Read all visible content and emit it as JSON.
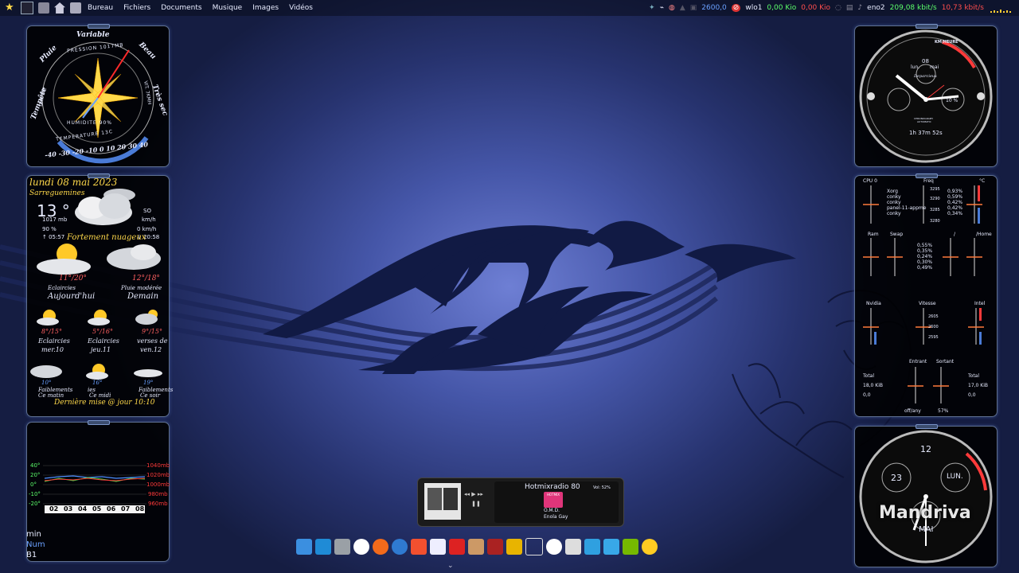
{
  "top_panel": {
    "menu": [
      "Bureau",
      "Fichiers",
      "Documents",
      "Musique",
      "Images",
      "Vidéos"
    ],
    "freq": "2600,0",
    "wlo1_label": "wlo1",
    "wlo1_down": "0,00 Kio",
    "wlo1_up": "0,00 Kio",
    "eno2_label": "eno2",
    "eno2_down": "209,08 kbit/s",
    "eno2_up": "10,73 kbit/s"
  },
  "barometer": {
    "labels": [
      "Variable",
      "Pluie",
      "Beau",
      "Tempête",
      "Très sec"
    ],
    "pression": "PRESSION 1017MB",
    "humidite": "HUMIDITE 90%",
    "temperature": "TEMPERATURE 13C",
    "scale": "-40 -30 -20 -10 0 10 20 30 40",
    "wind": "VIT. 7KMH",
    "dir": "DIR. SO"
  },
  "weather": {
    "date": "lundi 08 mai 2023",
    "city": "Sarreguemines",
    "temp": "13 °",
    "pressure": "1017 mb",
    "humidity": "90 %",
    "sunrise": "↑ 05:57",
    "sunset": "↓ 20:58",
    "wind_dir": "SO",
    "wind_speed": "km/h",
    "gust": "0 km/h",
    "condition": "Fortement nuageux",
    "today": {
      "range": "11°/20°",
      "desc": "Eclaircies",
      "label": "Aujourd'hui"
    },
    "tomorrow": {
      "range": "12°/18°",
      "desc": "Pluie modérée",
      "label": "Demain"
    },
    "days": [
      {
        "range": "8°/15°",
        "desc": "Eclaircies",
        "day": "mer.10"
      },
      {
        "range": "5°/16°",
        "desc": "Eclaircies",
        "day": "jeu.11"
      },
      {
        "range": "9°/15°",
        "desc": "verses de",
        "day": "ven.12"
      }
    ],
    "periods": [
      {
        "temp": "10°",
        "desc": "Faiblements",
        "when": "Ce matin"
      },
      {
        "temp": "16°",
        "desc": "ies",
        "when": "Ce midi"
      },
      {
        "temp": "19°",
        "desc": "Faiblements",
        "when": "Ce soir"
      }
    ],
    "updated": "Dernière mise @ jour  10:10"
  },
  "graph": {
    "temps": [
      "40°",
      "20°",
      "0°",
      "-10°",
      "-20°"
    ],
    "pressures": [
      "1040mb",
      "1020mb",
      "1000mb",
      "980mb",
      "960mb"
    ],
    "days": [
      "02",
      "03",
      "04",
      "05",
      "06",
      "07",
      "08"
    ]
  },
  "status": {
    "line1": "min",
    "line2": "Num",
    "line3": "B1"
  },
  "clock": {
    "date": "08",
    "day": "lun.",
    "month": "mai",
    "brand": "Deparcieux",
    "sub1": "CHRONOGRAPH",
    "sub2": "AUTOMATIC",
    "duration": "1h 37m 52s",
    "pct": "10 %",
    "mode": "KM/HEURE"
  },
  "sysmon": {
    "cpu_label": "CPU 0",
    "freq_label": "Freq",
    "temp_label": "°C",
    "processes": [
      "Xorg",
      "conky",
      "conky",
      "panel-11-appme",
      "conky"
    ],
    "process_pct": [
      "0,93%",
      "0,59%",
      "0,42%",
      "0,42%",
      "0,34%"
    ],
    "freqs": [
      "3295",
      "3290",
      "3285",
      "3280"
    ],
    "ram_label": "Ram",
    "swap_label": "Swap",
    "root_label": "/",
    "home_label": "/Home",
    "mem_pct": [
      "0,55%",
      "0,35%",
      "0,24%",
      "0,30%",
      "0,49%"
    ],
    "nvidia_label": "Nvidia",
    "vitesse_label": "Vitesse",
    "intel_label": "Intel",
    "vitesse_vals": [
      "2605",
      "2600",
      "2595"
    ],
    "total_label": "Total",
    "in_total": "18,0 KiB",
    "in_val": "0,0",
    "entrant": "Entrant",
    "sortant": "Sortant",
    "out_total": "17,0 KiB",
    "out_val": "0,0",
    "offany": "off/any",
    "pct": "57%"
  },
  "clock2": {
    "twelve": "12",
    "date": "23",
    "day": "LUN.",
    "month": "MAI",
    "brand": "Mandriva"
  },
  "player": {
    "title": "Hotmixradio 80",
    "vol": "Vol: 52%",
    "artist": "O.M.D.",
    "track": "Enola Gay",
    "logo": "HOTMIX"
  },
  "colors": {
    "accent_yellow": "#ffd94a",
    "accent_red": "#ff3a3a",
    "frame": "#aac8ff"
  }
}
